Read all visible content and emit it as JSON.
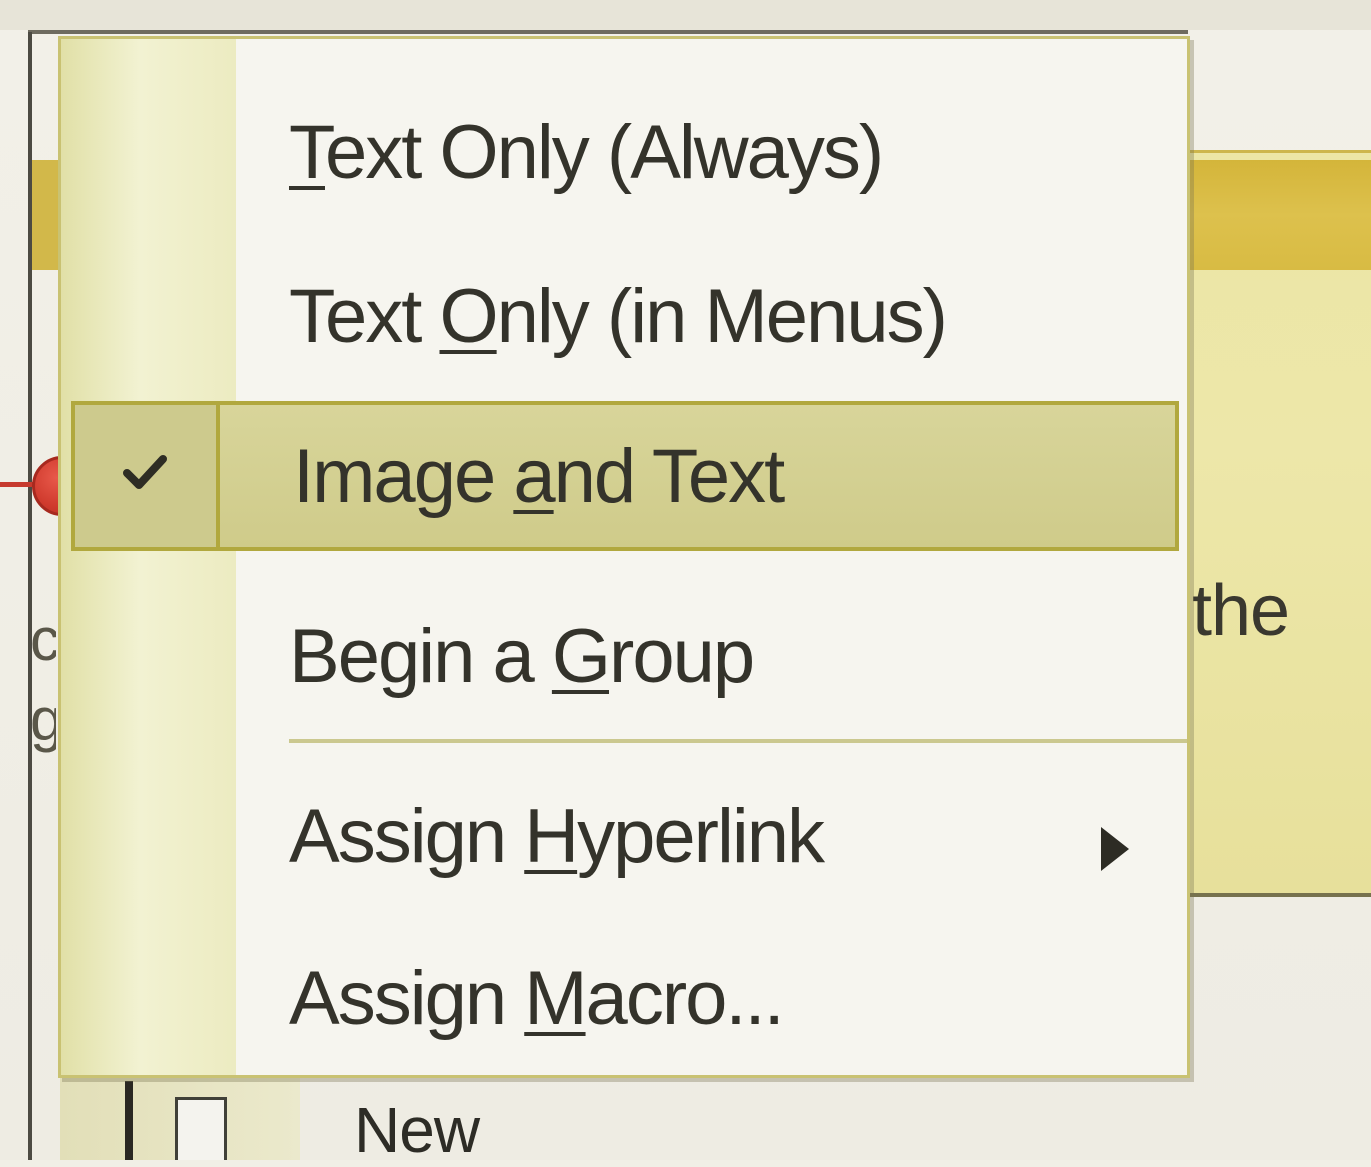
{
  "background": {
    "the_fragment": "the",
    "left_fragment": "c\ng",
    "new_item_label": "New"
  },
  "context_menu": {
    "items": [
      {
        "pre": "",
        "accel": "T",
        "post": "ext Only (Always)"
      },
      {
        "pre": "Text ",
        "accel": "O",
        "post": "nly (in Menus)"
      },
      {
        "pre": "Image ",
        "accel": "a",
        "post": "nd Text",
        "checked": true,
        "highlighted": true
      },
      {
        "pre": "Begin a ",
        "accel": "G",
        "post": "roup"
      },
      {
        "pre": "Assign ",
        "accel": "H",
        "post": "yperlink",
        "has_submenu": true
      },
      {
        "pre": "Assign ",
        "accel": "M",
        "post": "acro..."
      }
    ]
  },
  "icons": {
    "check": "check-icon",
    "submenu_arrow": "submenu-arrow-icon",
    "callout_marker": "callout-marker-icon",
    "document": "document-icon"
  },
  "colors": {
    "highlight_fill": "#d3d093",
    "highlight_border": "#b1a83e",
    "callout": "#cf3a2d",
    "accent_band": "#d4b53a"
  }
}
